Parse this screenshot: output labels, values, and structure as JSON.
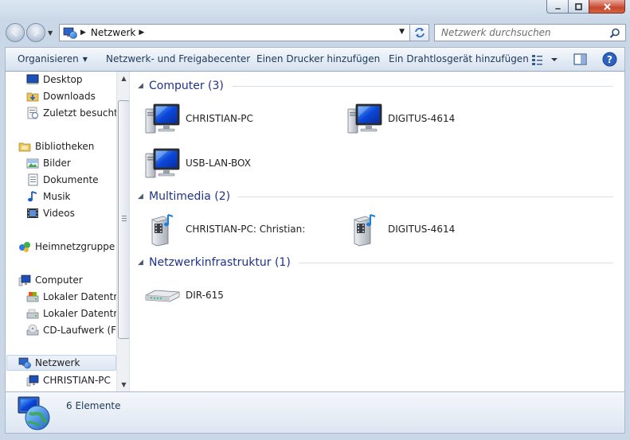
{
  "window": {
    "minimize_icon": "minimize-icon",
    "maximize_icon": "maximize-icon",
    "close_icon": "close-icon"
  },
  "address": {
    "location": "Netzwerk",
    "icon": "network-icon"
  },
  "search": {
    "placeholder": "Netzwerk durchsuchen"
  },
  "toolbar": {
    "organize": "Organisieren",
    "network_center": "Netzwerk- und Freigabecenter",
    "add_printer": "Einen Drucker hinzufügen",
    "add_wireless": "Ein Drahtlosgerät hinzufügen"
  },
  "nav": {
    "items": [
      {
        "label": "Desktop",
        "icon": "desktop-icon"
      },
      {
        "label": "Downloads",
        "icon": "downloads-folder-icon"
      },
      {
        "label": "Zuletzt besucht",
        "icon": "recent-places-icon"
      },
      {
        "label": "Bibliotheken",
        "icon": "libraries-icon"
      },
      {
        "label": "Bilder",
        "icon": "pictures-icon"
      },
      {
        "label": "Dokumente",
        "icon": "documents-icon"
      },
      {
        "label": "Musik",
        "icon": "music-icon"
      },
      {
        "label": "Videos",
        "icon": "videos-icon"
      },
      {
        "label": "Heimnetzgruppe",
        "icon": "homegroup-icon"
      },
      {
        "label": "Computer",
        "icon": "computer-icon"
      },
      {
        "label": "Lokaler Datenträger (C:)",
        "icon": "drive-icon"
      },
      {
        "label": "Lokaler Datenträger (D:)",
        "icon": "drive-icon"
      },
      {
        "label": "CD-Laufwerk (F:)",
        "icon": "cd-drive-icon"
      },
      {
        "label": "Netzwerk",
        "icon": "network-icon"
      },
      {
        "label": "CHRISTIAN-PC",
        "icon": "computer-icon"
      }
    ]
  },
  "groups": [
    {
      "title": "Computer (3)",
      "items": [
        "CHRISTIAN-PC",
        "DIGITUS-4614",
        "USB-LAN-BOX"
      ]
    },
    {
      "title": "Multimedia (2)",
      "items": [
        "CHRISTIAN-PC: Christian:",
        "DIGITUS-4614"
      ]
    },
    {
      "title": "Netzwerkinfrastruktur (1)",
      "items": [
        "DIR-615"
      ]
    }
  ],
  "details": {
    "count": "6 Elemente"
  },
  "colors": {
    "group_title": "#1e3287",
    "toolbar_text": "#1e395b",
    "frame": "#c9d7e6"
  }
}
